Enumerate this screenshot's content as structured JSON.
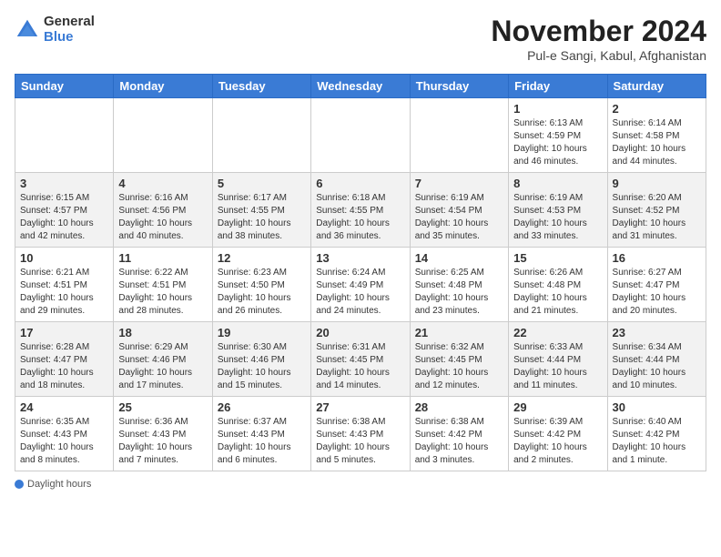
{
  "logo": {
    "general": "General",
    "blue": "Blue"
  },
  "title": "November 2024",
  "location": "Pul-e Sangi, Kabul, Afghanistan",
  "days_of_week": [
    "Sunday",
    "Monday",
    "Tuesday",
    "Wednesday",
    "Thursday",
    "Friday",
    "Saturday"
  ],
  "weeks": [
    [
      {
        "num": "",
        "info": ""
      },
      {
        "num": "",
        "info": ""
      },
      {
        "num": "",
        "info": ""
      },
      {
        "num": "",
        "info": ""
      },
      {
        "num": "",
        "info": ""
      },
      {
        "num": "1",
        "info": "Sunrise: 6:13 AM\nSunset: 4:59 PM\nDaylight: 10 hours and 46 minutes."
      },
      {
        "num": "2",
        "info": "Sunrise: 6:14 AM\nSunset: 4:58 PM\nDaylight: 10 hours and 44 minutes."
      }
    ],
    [
      {
        "num": "3",
        "info": "Sunrise: 6:15 AM\nSunset: 4:57 PM\nDaylight: 10 hours and 42 minutes."
      },
      {
        "num": "4",
        "info": "Sunrise: 6:16 AM\nSunset: 4:56 PM\nDaylight: 10 hours and 40 minutes."
      },
      {
        "num": "5",
        "info": "Sunrise: 6:17 AM\nSunset: 4:55 PM\nDaylight: 10 hours and 38 minutes."
      },
      {
        "num": "6",
        "info": "Sunrise: 6:18 AM\nSunset: 4:55 PM\nDaylight: 10 hours and 36 minutes."
      },
      {
        "num": "7",
        "info": "Sunrise: 6:19 AM\nSunset: 4:54 PM\nDaylight: 10 hours and 35 minutes."
      },
      {
        "num": "8",
        "info": "Sunrise: 6:19 AM\nSunset: 4:53 PM\nDaylight: 10 hours and 33 minutes."
      },
      {
        "num": "9",
        "info": "Sunrise: 6:20 AM\nSunset: 4:52 PM\nDaylight: 10 hours and 31 minutes."
      }
    ],
    [
      {
        "num": "10",
        "info": "Sunrise: 6:21 AM\nSunset: 4:51 PM\nDaylight: 10 hours and 29 minutes."
      },
      {
        "num": "11",
        "info": "Sunrise: 6:22 AM\nSunset: 4:51 PM\nDaylight: 10 hours and 28 minutes."
      },
      {
        "num": "12",
        "info": "Sunrise: 6:23 AM\nSunset: 4:50 PM\nDaylight: 10 hours and 26 minutes."
      },
      {
        "num": "13",
        "info": "Sunrise: 6:24 AM\nSunset: 4:49 PM\nDaylight: 10 hours and 24 minutes."
      },
      {
        "num": "14",
        "info": "Sunrise: 6:25 AM\nSunset: 4:48 PM\nDaylight: 10 hours and 23 minutes."
      },
      {
        "num": "15",
        "info": "Sunrise: 6:26 AM\nSunset: 4:48 PM\nDaylight: 10 hours and 21 minutes."
      },
      {
        "num": "16",
        "info": "Sunrise: 6:27 AM\nSunset: 4:47 PM\nDaylight: 10 hours and 20 minutes."
      }
    ],
    [
      {
        "num": "17",
        "info": "Sunrise: 6:28 AM\nSunset: 4:47 PM\nDaylight: 10 hours and 18 minutes."
      },
      {
        "num": "18",
        "info": "Sunrise: 6:29 AM\nSunset: 4:46 PM\nDaylight: 10 hours and 17 minutes."
      },
      {
        "num": "19",
        "info": "Sunrise: 6:30 AM\nSunset: 4:46 PM\nDaylight: 10 hours and 15 minutes."
      },
      {
        "num": "20",
        "info": "Sunrise: 6:31 AM\nSunset: 4:45 PM\nDaylight: 10 hours and 14 minutes."
      },
      {
        "num": "21",
        "info": "Sunrise: 6:32 AM\nSunset: 4:45 PM\nDaylight: 10 hours and 12 minutes."
      },
      {
        "num": "22",
        "info": "Sunrise: 6:33 AM\nSunset: 4:44 PM\nDaylight: 10 hours and 11 minutes."
      },
      {
        "num": "23",
        "info": "Sunrise: 6:34 AM\nSunset: 4:44 PM\nDaylight: 10 hours and 10 minutes."
      }
    ],
    [
      {
        "num": "24",
        "info": "Sunrise: 6:35 AM\nSunset: 4:43 PM\nDaylight: 10 hours and 8 minutes."
      },
      {
        "num": "25",
        "info": "Sunrise: 6:36 AM\nSunset: 4:43 PM\nDaylight: 10 hours and 7 minutes."
      },
      {
        "num": "26",
        "info": "Sunrise: 6:37 AM\nSunset: 4:43 PM\nDaylight: 10 hours and 6 minutes."
      },
      {
        "num": "27",
        "info": "Sunrise: 6:38 AM\nSunset: 4:43 PM\nDaylight: 10 hours and 5 minutes."
      },
      {
        "num": "28",
        "info": "Sunrise: 6:38 AM\nSunset: 4:42 PM\nDaylight: 10 hours and 3 minutes."
      },
      {
        "num": "29",
        "info": "Sunrise: 6:39 AM\nSunset: 4:42 PM\nDaylight: 10 hours and 2 minutes."
      },
      {
        "num": "30",
        "info": "Sunrise: 6:40 AM\nSunset: 4:42 PM\nDaylight: 10 hours and 1 minute."
      }
    ]
  ],
  "footer": {
    "daylight_label": "Daylight hours"
  }
}
